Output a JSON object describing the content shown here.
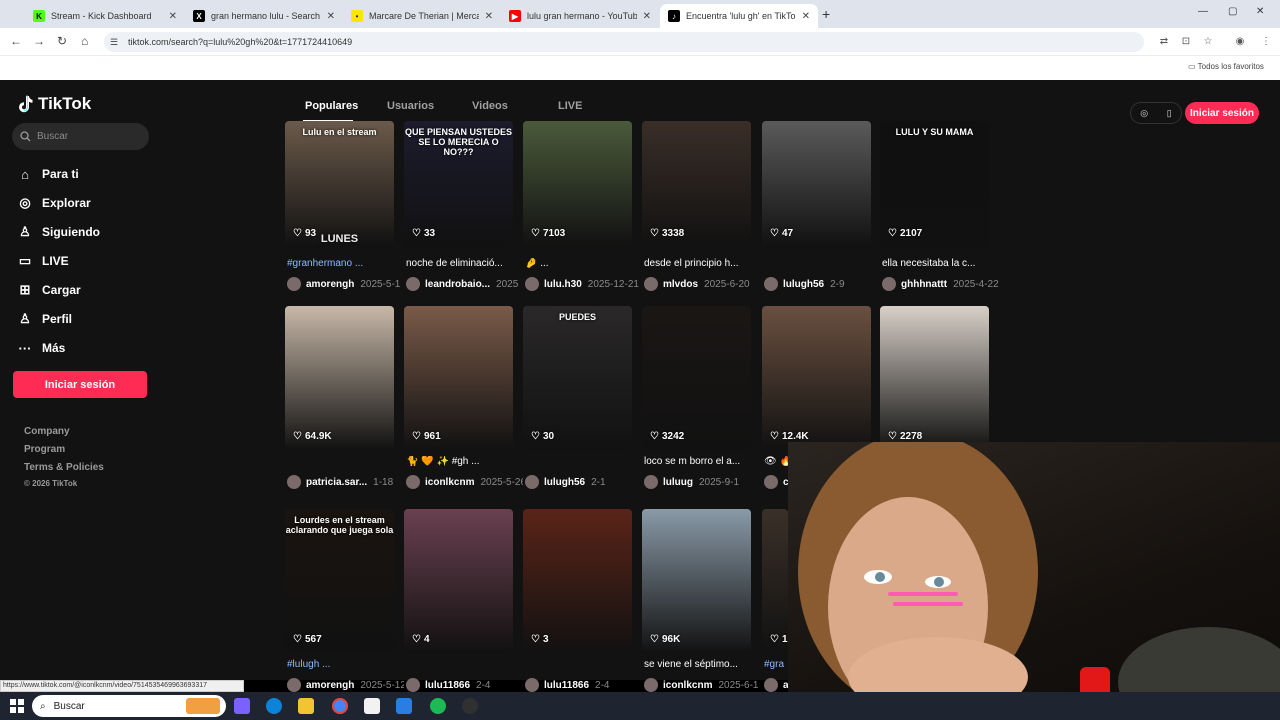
{
  "browser": {
    "tabs": [
      {
        "title": "Stream - Kick Dashboard",
        "icon": "kick-icon",
        "color": "#53fc18"
      },
      {
        "title": "gran hermano lulu - Search / X",
        "icon": "x-icon",
        "color": "#000000"
      },
      {
        "title": "Marcare De Therian | Mercadol...",
        "icon": "mercadolibre-icon",
        "color": "#ffe600"
      },
      {
        "title": "lulu gran hermano - YouTube",
        "icon": "youtube-icon",
        "color": "#ff0000"
      },
      {
        "title": "Encuentra 'lulu gh' en TikTok |",
        "icon": "tiktok-icon",
        "color": "#000000"
      }
    ],
    "url": "tiktok.com/search?q=lulu%20gh%20&t=1771724410649",
    "bookmarks_label": "Todos los favoritos"
  },
  "tiktok": {
    "logo": "TikTok",
    "search_placeholder": "Buscar",
    "nav": [
      {
        "label": "Para ti",
        "icon": "home-icon"
      },
      {
        "label": "Explorar",
        "icon": "compass-icon"
      },
      {
        "label": "Siguiendo",
        "icon": "following-icon"
      },
      {
        "label": "LIVE",
        "icon": "live-icon"
      },
      {
        "label": "Cargar",
        "icon": "upload-icon"
      },
      {
        "label": "Perfil",
        "icon": "profile-icon"
      },
      {
        "label": "Más",
        "icon": "more-icon"
      }
    ],
    "login_label": "Iniciar sesión",
    "footer": [
      "Company",
      "Program",
      "Terms & Policies",
      "© 2026 TikTok"
    ],
    "tabs": [
      "Populares",
      "Usuarios",
      "Videos",
      "LIVE"
    ],
    "active_tab": "Populares",
    "header_login": "Iniciar sesión",
    "rows": [
      [
        {
          "likes": "93",
          "caption": "#granhermano ...",
          "user": "amorengh",
          "date": "2025-5-1",
          "overlay_top": "Lulu en el stream",
          "overlay_bottom": "LUNES",
          "bg": "#6b5a4a"
        },
        {
          "likes": "33",
          "caption": "noche de eliminació...",
          "user": "leandrobaio...",
          "date": "2025",
          "overlay_top": "QUE PIENSAN USTEDES SE LO MERECIA O NO???",
          "overlay_bottom": "",
          "bg": "#1c1c2e"
        },
        {
          "likes": "7103",
          "caption": "🤌 ...",
          "user": "lulu.h30",
          "date": "2025-12-21",
          "overlay_top": "",
          "overlay_bottom": "",
          "bg": "#4a5a3a"
        },
        {
          "likes": "3338",
          "caption": "desde el principio h...",
          "user": "mlvdos",
          "date": "2025-6-20",
          "overlay_top": "",
          "overlay_bottom": "",
          "bg": "#3a2e28"
        },
        {
          "likes": "47",
          "caption": "",
          "user": "lulugh56",
          "date": "2-9",
          "overlay_top": "",
          "overlay_bottom": "",
          "bg": "#5a5a5a"
        },
        {
          "likes": "2107",
          "caption": "ella necesitaba la c...",
          "user": "ghhhnattt",
          "date": "2025-4-22",
          "overlay_top": "LULU Y SU MAMA",
          "overlay_bottom": "",
          "bg": "#101010"
        }
      ],
      [
        {
          "likes": "64.9K",
          "caption": "",
          "user": "patricia.sar...",
          "date": "1-18",
          "overlay_top": "",
          "overlay_bottom": "",
          "bg": "#c8b8a8"
        },
        {
          "likes": "961",
          "caption": "🐈 🧡 ✨ #gh ...",
          "user": "iconlkcnm",
          "date": "2025-5-26",
          "overlay_top": "",
          "overlay_bottom": "",
          "bg": "#7a5a48"
        },
        {
          "likes": "30",
          "caption": "",
          "user": "lulugh56",
          "date": "2-1",
          "overlay_top": "PUEDES",
          "overlay_bottom": "",
          "bg": "#2a2828"
        },
        {
          "likes": "3242",
          "caption": "loco se m borro el a...",
          "user": "luluug",
          "date": "2025-9-1",
          "overlay_top": "",
          "overlay_bottom": "",
          "bg": "#1a1614"
        },
        {
          "likes": "12.4K",
          "caption": "👁 🔥",
          "user": "c",
          "date": "",
          "overlay_top": "",
          "overlay_bottom": "",
          "bg": "#6a5040"
        },
        {
          "likes": "2278",
          "caption": "",
          "user": "",
          "date": "",
          "overlay_top": "",
          "overlay_bottom": "",
          "bg": "#d8d0c8"
        }
      ],
      [
        {
          "likes": "567",
          "caption": "#lulugh ...",
          "user": "amorengh",
          "date": "2025-5-12",
          "overlay_top": "Lourdes en el stream aclarando que juega sola",
          "overlay_bottom": "",
          "bg": "#1a1410"
        },
        {
          "likes": "4",
          "caption": "",
          "user": "lulu11866",
          "date": "2-4",
          "overlay_top": "",
          "overlay_bottom": "",
          "bg": "#6a4050"
        },
        {
          "likes": "3",
          "caption": "",
          "user": "lulu11866",
          "date": "2-4",
          "overlay_top": "",
          "overlay_bottom": "",
          "bg": "#5a2418"
        },
        {
          "likes": "96K",
          "caption": "se viene el séptimo...",
          "user": "iconlkcnm",
          "date": "2025-6-1",
          "overlay_top": "",
          "overlay_bottom": "",
          "bg": "#8a9aa8"
        },
        {
          "likes": "1",
          "caption": "#gra",
          "user": "a",
          "date": "",
          "overlay_top": "",
          "overlay_bottom": "",
          "bg": "#3a3028"
        }
      ]
    ]
  },
  "status_url": "https://www.tiktok.com/@iconlkcnm/video/7514535469963693317",
  "taskbar": {
    "search_label": "Buscar",
    "apps": [
      {
        "name": "copilot-icon",
        "color": "#7b61ff"
      },
      {
        "name": "edge-icon",
        "color": "#0a84d8"
      },
      {
        "name": "explorer-icon",
        "color": "#f4c430"
      },
      {
        "name": "chrome-icon",
        "color": "#4285f4"
      },
      {
        "name": "store-icon",
        "color": "#f2f2f2"
      },
      {
        "name": "app-icon",
        "color": "#2a7de1"
      },
      {
        "name": "spotify-icon",
        "color": "#1db954"
      },
      {
        "name": "obs-icon",
        "color": "#303030"
      }
    ]
  },
  "colors": {
    "accent": "#fe2c55",
    "bg": "#121212",
    "hashtag": "#8dbbff"
  }
}
